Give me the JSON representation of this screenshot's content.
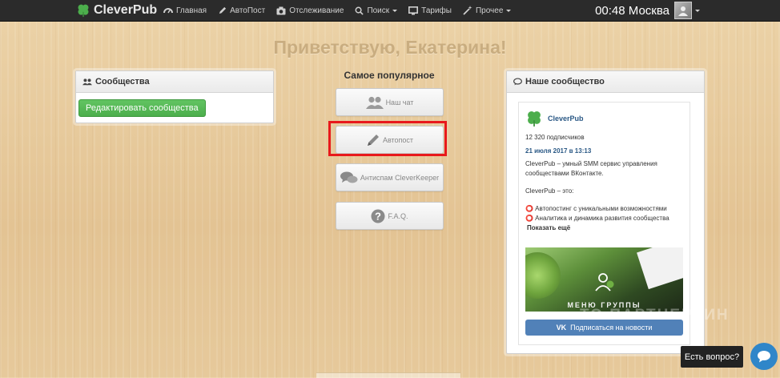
{
  "brand": {
    "name": "CleverPub"
  },
  "nav": {
    "items": [
      {
        "label": "Главная",
        "icon": "dashboard-icon"
      },
      {
        "label": "АвтоПост",
        "icon": "pencil-icon"
      },
      {
        "label": "Отслеживание",
        "icon": "camera-icon"
      },
      {
        "label": "Поиск",
        "icon": "search-icon",
        "dropdown": true
      },
      {
        "label": "Тарифы",
        "icon": "monitor-icon"
      },
      {
        "label": "Прочее",
        "icon": "magic-icon",
        "dropdown": true
      }
    ],
    "clock": "00:48 Москва"
  },
  "greeting": "Приветствую, Екатерина!",
  "communities": {
    "title": "Сообщества",
    "edit_button": "Редактировать сообщества"
  },
  "popular": {
    "title": "Самое популярное",
    "tiles": [
      {
        "label": "Наш чат",
        "icon": "users-icon"
      },
      {
        "label": "Автопост",
        "icon": "pencil-icon"
      },
      {
        "label": "Антиспам CleverKeeper",
        "icon": "comments-icon"
      },
      {
        "label": "F.A.Q.",
        "icon": "question-icon"
      }
    ]
  },
  "our_community": {
    "title": "Наше сообщество",
    "widget": {
      "name": "CleverPub",
      "subscribers": "12 320 подписчиков",
      "date": "21 июля 2017 в 13:13",
      "text1": "CleverPub – умный SMM сервис управления сообществами ВКонтакте.",
      "text2": "CleverPub – это:",
      "bullet1": "⭕ Автопостинг с уникальными возможностями",
      "bullet2": "⭕ Аналитика и динамика развития сообщества",
      "show_more": "Показать ещё",
      "banner_label": "МЕНЮ ГРУППЫ",
      "subscribe_button": "Подписаться на новости",
      "vk_logo": "VK"
    }
  },
  "watermark": "ТО ПАРТНЕРКИН",
  "chat": {
    "label": "Есть вопрос?"
  },
  "colors": {
    "accent_green": "#4cae4c",
    "highlight_red": "#e8191c",
    "vk_blue": "#5181b8",
    "nav_bg": "#2b2b2b"
  }
}
